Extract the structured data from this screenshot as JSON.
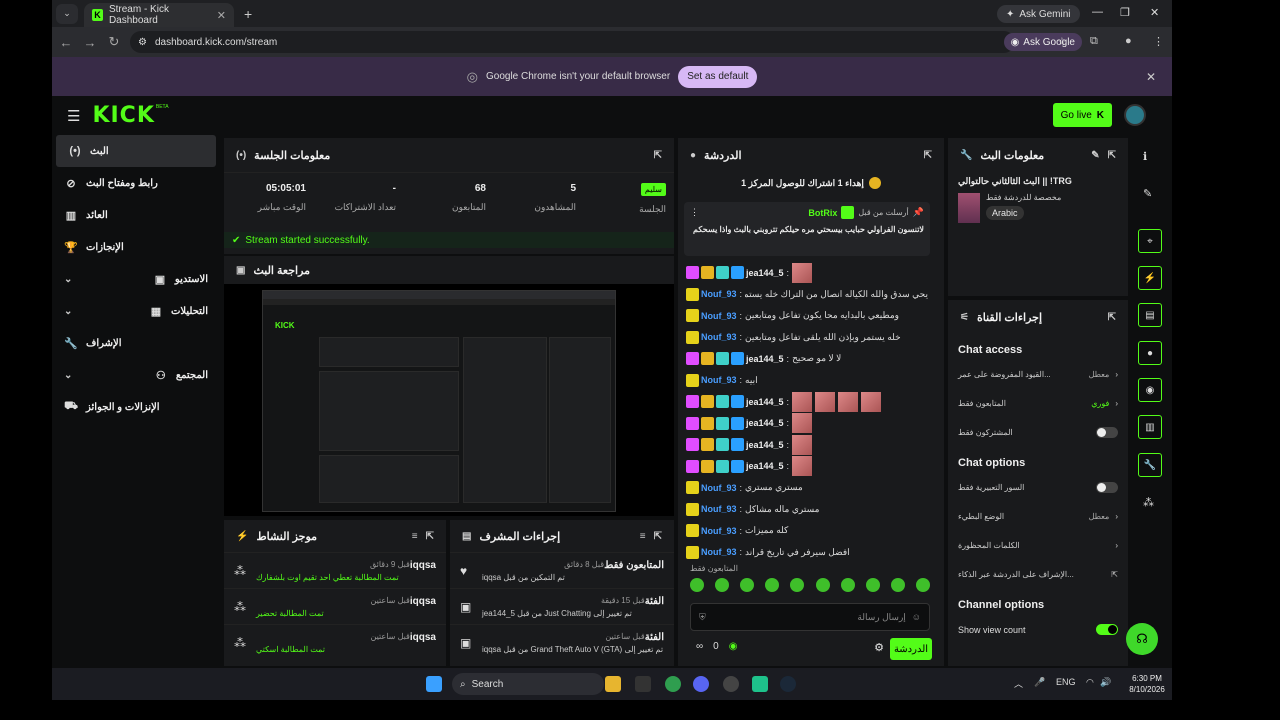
{
  "browser": {
    "tab_title": "Stream - Kick Dashboard",
    "ask_gemini": "Ask Gemini",
    "url": "dashboard.kick.com/stream",
    "ask_google": "Ask Google",
    "infobar_text": "Google Chrome isn't your default browser",
    "set_default": "Set as default"
  },
  "header": {
    "logo": "KICK",
    "beta": "BETA",
    "go_live": "Go live"
  },
  "sidebar": {
    "items": [
      {
        "label": "البث",
        "icon": "live-icon"
      },
      {
        "label": "رابط ومفتاح البث",
        "icon": "link-icon"
      },
      {
        "label": "العائد",
        "icon": "revenue-icon"
      },
      {
        "label": "الإنجازات",
        "icon": "trophy-icon"
      },
      {
        "label": "الاستديو",
        "icon": "studio-icon"
      },
      {
        "label": "التحليلات",
        "icon": "analytics-icon"
      },
      {
        "label": "الإشراف",
        "icon": "wrench-icon"
      },
      {
        "label": "المجتمع",
        "icon": "community-icon"
      },
      {
        "label": "الإنزالات و الجوائز",
        "icon": "drops-icon"
      }
    ]
  },
  "session": {
    "title": "معلومات الجلسة",
    "stats": [
      {
        "value": "05:05:01",
        "label": "الوقت مباشر"
      },
      {
        "value": "-",
        "label": "تعداد الاشتراكات"
      },
      {
        "value": "68",
        "label": "المتابعون"
      },
      {
        "value": "5",
        "label": "المشاهدون"
      },
      {
        "value": "سليم",
        "label": "الجلسة"
      }
    ],
    "success": "Stream started successfully."
  },
  "preview": {
    "title": "مراجعة البث"
  },
  "activity": {
    "title": "موجز النشاط",
    "items": [
      {
        "name": "iqqsa",
        "desc": "تمت المطالبة تعطي احد تقيم اوت بلشفارك",
        "time": "قبل 9 دقائق"
      },
      {
        "name": "iqqsa",
        "desc": "تمت المطالبة تحضير",
        "time": "قبل ساعتين"
      },
      {
        "name": "iqqsa",
        "desc": "تمت المطالبة اسكتي",
        "time": "قبل ساعتين"
      }
    ]
  },
  "mod": {
    "title": "إجراءات المشرف",
    "items": [
      {
        "name": "المتابعون فقط",
        "desc": "تم التمكين من قبل iqqsa",
        "time": "قبل 8 دقائق"
      },
      {
        "name": "الفئة",
        "desc": "تم تغيير إلى Just Chatting من قبل jea144_5",
        "time": "قبل 15 دقيقة"
      },
      {
        "name": "الفئة",
        "desc": "تم تغيير إلى Grand Theft Auto V (GTA) من قبل iqqsa",
        "time": "قبل ساعتين"
      }
    ]
  },
  "chat": {
    "title": "الدردشة",
    "banner": "إهداء 1 اشتراك للوصول المركز 1",
    "pinned_time": "أرسلت من قبل",
    "pinned_user": "BotRix",
    "pinned_text": "لاتنسون الفراولي حبايب بيسحتي مره حيلكم تتروبني بالبث واذا يسحكم",
    "messages": [
      {
        "user": "jea144_5",
        "text": "",
        "color": "#eee",
        "emotes": 1,
        "sub": true
      },
      {
        "user": "Nouf_93",
        "text": "يحي سدق والله الكياله انصال من التراك خله يستمر بالكياك",
        "color": "#4a9eff"
      },
      {
        "user": "Nouf_93",
        "text": "ومطيعي بالبدايه محا يكون تفاعل ومتابعين",
        "color": "#4a9eff"
      },
      {
        "user": "Nouf_93",
        "text": "خله يستمر وبإذن الله يلقى تفاعل ومتابعين",
        "color": "#4a9eff"
      },
      {
        "user": "jea144_5",
        "text": "لا لا مو صحيح",
        "color": "#eee",
        "sub": true
      },
      {
        "user": "Nouf_93",
        "text": "ابيه",
        "color": "#4a9eff"
      },
      {
        "user": "jea144_5",
        "text": "",
        "color": "#eee",
        "emotes": 4,
        "sub": true
      },
      {
        "user": "jea144_5",
        "text": "",
        "color": "#eee",
        "emotes": 1,
        "sub": true
      },
      {
        "user": "jea144_5",
        "text": "",
        "color": "#eee",
        "emotes": 1,
        "sub": true
      },
      {
        "user": "jea144_5",
        "text": "",
        "color": "#eee",
        "emotes": 1,
        "sub": true
      },
      {
        "user": "Nouf_93",
        "text": "مستري مستري",
        "color": "#4a9eff"
      },
      {
        "user": "Nouf_93",
        "text": "مستري ماله مشاكل",
        "color": "#4a9eff"
      },
      {
        "user": "Nouf_93",
        "text": "كله مميزات",
        "color": "#4a9eff"
      },
      {
        "user": "Nouf_93",
        "text": "افضل سيرفر في تاريخ قراند",
        "color": "#4a9eff"
      }
    ],
    "followers_only": "المتابعون فقط",
    "placeholder": "إرسال رسالة",
    "send": "الدردشة",
    "count": "0"
  },
  "stream_info": {
    "title": "معلومات البث",
    "stream_title": "TRG! || البث الثالثاني حالتوالي",
    "category": "مخصصة للدردشة فقط",
    "tag": "Arabic"
  },
  "channel_actions": {
    "title": "إجراءات القناة",
    "chat_access": "Chat access",
    "access_rows": [
      {
        "label": "القيود المفروضة على عمر...",
        "value": "معطل",
        "type": "chev"
      },
      {
        "label": "المتابعون فقط",
        "value": "فوري",
        "type": "chev"
      },
      {
        "label": "المشتركون فقط",
        "value": "",
        "type": "toggle"
      }
    ],
    "chat_options": "Chat options",
    "option_rows": [
      {
        "label": "السور التعبيرية فقط",
        "value": "",
        "type": "toggle"
      },
      {
        "label": "الوضع البطيء",
        "value": "معطل",
        "type": "chev"
      },
      {
        "label": "الكلمات المحظورة",
        "value": "",
        "type": "chev"
      },
      {
        "label": "الإشراف على الدردشة عبر الذكاء...",
        "value": "",
        "type": "ext"
      }
    ],
    "channel_options": "Channel options",
    "show_view_count": "Show view count"
  },
  "taskbar": {
    "search": "Search",
    "lang": "ENG",
    "time": "6:30 PM",
    "date": "8/10/2026"
  }
}
